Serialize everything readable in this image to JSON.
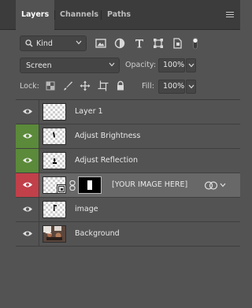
{
  "tabs": [
    {
      "label": "Layers",
      "active": true
    },
    {
      "label": "Channels",
      "active": false
    },
    {
      "label": "Paths",
      "active": false
    }
  ],
  "filter": {
    "kind_label": "Kind",
    "icons": [
      "image-filter-icon",
      "adjustment-filter-icon",
      "type-filter-icon",
      "shape-filter-icon",
      "smart-object-filter-icon",
      "filter-toggle-icon"
    ]
  },
  "blend": {
    "mode": "Screen",
    "opacity_label": "Opacity:",
    "opacity_value": "100%",
    "lock_label": "Lock:",
    "fill_label": "Fill:",
    "fill_value": "100%"
  },
  "layers": [
    {
      "name": "Layer 1",
      "visibility": "normal",
      "thumb": "transparent",
      "selected": false
    },
    {
      "name": "Adjust Brightness",
      "visibility": "green",
      "thumb": "brush-stroke",
      "selected": false
    },
    {
      "name": "Adjust Reflection",
      "visibility": "green",
      "thumb": "brush-stroke-small",
      "selected": false
    },
    {
      "name": "[YOUR IMAGE HERE]",
      "visibility": "red",
      "thumb": "smart-object-with-mask",
      "selected": true
    },
    {
      "name": "image",
      "visibility": "normal",
      "thumb": "transparent-mark",
      "selected": false
    },
    {
      "name": "Background",
      "visibility": "normal",
      "thumb": "photo",
      "selected": false
    }
  ],
  "colors": {
    "panel_bg": "#535353",
    "tab_bar_bg": "#3c3c3c",
    "selected_row": "#686868",
    "visibility_green": "#5b8a3a",
    "visibility_red": "#c1404a"
  }
}
